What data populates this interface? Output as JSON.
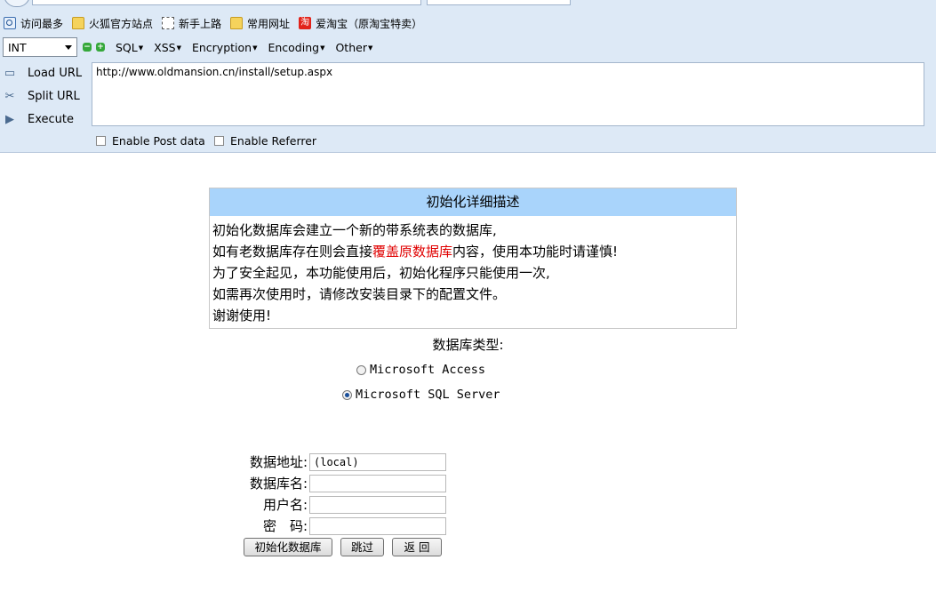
{
  "bookmarks": [
    {
      "label": "访问最多",
      "icon": "search-icon"
    },
    {
      "label": "火狐官方站点",
      "icon": "folder-icon"
    },
    {
      "label": "新手上路",
      "icon": "dashed-page-icon"
    },
    {
      "label": "常用网址",
      "icon": "folder-icon"
    },
    {
      "label": "爱淘宝（原淘宝特卖）",
      "icon": "taobao-icon",
      "icon_text": "淘"
    }
  ],
  "hackbar": {
    "type_select": "INT",
    "menus": [
      "SQL",
      "XSS",
      "Encryption",
      "Encoding",
      "Other"
    ],
    "load_url": "Load URL",
    "split_url": "Split URL",
    "execute": "Execute",
    "url_value": "http://www.oldmansion.cn/install/setup.aspx",
    "enable_post": "Enable Post data",
    "enable_referrer": "Enable Referrer"
  },
  "description": {
    "title": "初始化详细描述",
    "line1": "初始化数据库会建立一个新的带系统表的数据库,",
    "line2_pre": "如有老数据库存在则会直接",
    "line2_red": "覆盖原数据库",
    "line2_post": "内容，使用本功能时请谨慎!",
    "line3": "为了安全起见，本功能使用后，初始化程序只能使用一次,",
    "line4": "如需再次使用时，请修改安装目录下的配置文件。",
    "line5": "谢谢使用!"
  },
  "dbtype": {
    "label": "数据库类型:",
    "option_access": "Microsoft Access",
    "option_sqlserver": "Microsoft SQL Server",
    "selected": "Microsoft SQL Server"
  },
  "form": {
    "address_label": "数据地址:",
    "address_value": "(local)",
    "dbname_label": "数据库名:",
    "dbname_value": "",
    "username_label": "用户名:",
    "username_value": "",
    "password_label": "密　码:",
    "password_value": ""
  },
  "buttons": {
    "init": "初始化数据库",
    "skip": "跳过",
    "back": "返 回"
  },
  "colors": {
    "chrome_bg": "#dde9f6",
    "desc_title_bg": "#a9d4fb",
    "warning_red": "#e00000"
  }
}
